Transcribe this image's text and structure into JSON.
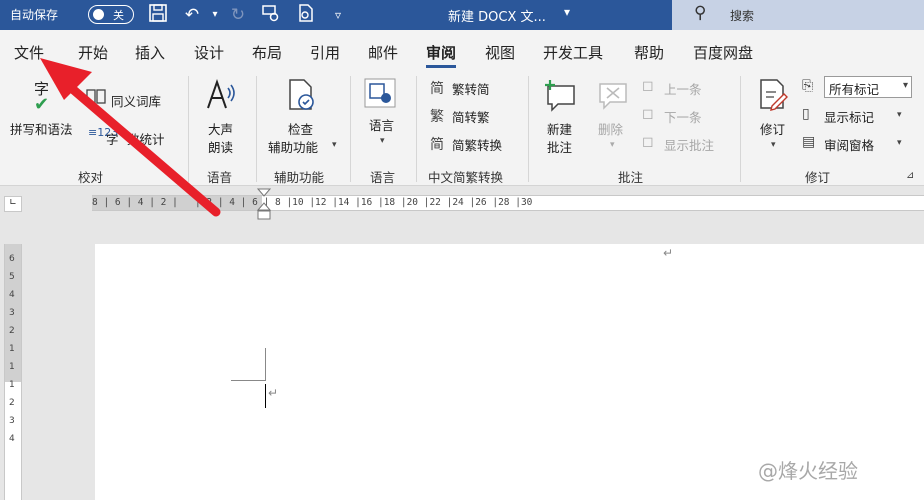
{
  "titlebar": {
    "autosave_label": "自动保存",
    "toggle_state": "关",
    "doc_title": "新建 DOCX 文...",
    "search_placeholder": "搜索"
  },
  "tabs": [
    "文件",
    "开始",
    "插入",
    "设计",
    "布局",
    "引用",
    "邮件",
    "审阅",
    "视图",
    "开发工具",
    "帮助",
    "百度网盘"
  ],
  "active_tab": "审阅",
  "ribbon": {
    "proofing": {
      "label": "校对",
      "spelling": "拼写和语法",
      "char_top": "字",
      "thesaurus": "同义词库",
      "wordcount_prefix": "字",
      "wordcount_suffix": "数统计"
    },
    "speech": {
      "label": "语音",
      "read_aloud_1": "大声",
      "read_aloud_2": "朗读"
    },
    "accessibility": {
      "label": "辅助功能",
      "check_1": "检查",
      "check_2": "辅助功能"
    },
    "language": {
      "label": "语言"
    },
    "chinese_conv": {
      "label": "中文简繁转换",
      "to_simplified": "繁转简",
      "to_traditional": "简转繁",
      "convert": "简繁转换"
    },
    "comments": {
      "label": "批注",
      "new_1": "新建",
      "new_2": "批注",
      "delete": "删除",
      "prev": "上一条",
      "next": "下一条",
      "show": "显示批注"
    },
    "tracking": {
      "label": "修订",
      "track": "修订",
      "markup_select": "所有标记",
      "show_markup": "显示标记",
      "review_pane": "审阅窗格"
    }
  },
  "ruler_text": "8 | 6 | 4 | 2 |   | 2 | 4 | 6 | 8 |10 |12 |14 |16 |18 |20 |22 |24 |26 |28 |30",
  "vruler_text": "6 5 4 3 2 1 1 1 2 3 4",
  "watermark": "@烽火经验",
  "colors": {
    "titlebar": "#2b579a",
    "arrow": "#e8202a"
  }
}
